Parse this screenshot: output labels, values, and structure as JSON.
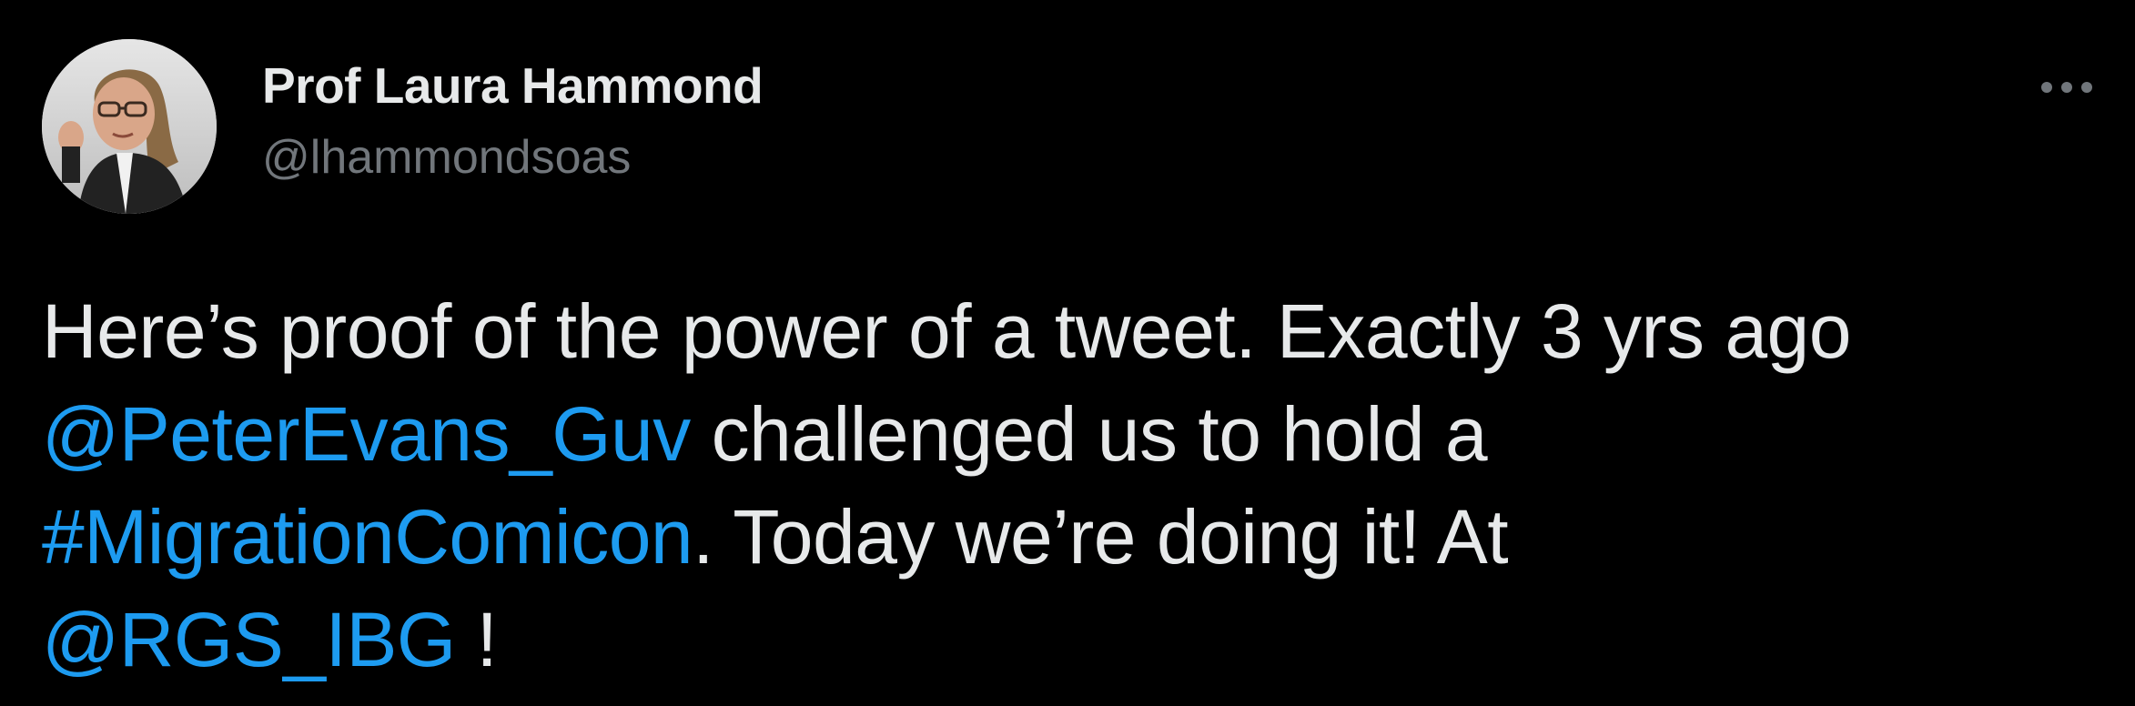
{
  "author": {
    "display_name": "Prof Laura Hammond",
    "handle": "@lhammondsoas"
  },
  "more_icon": "more-horizontal-icon",
  "tweet": {
    "line1": "Here’s proof of the power of a tweet. Exactly 3 yrs ago",
    "mention1": "@PeterEvans_Guv",
    "line2_rest": " challenged us to hold a",
    "hashtag": "#MigrationComicon",
    "line3_rest": ". Today we’re doing it! At",
    "mention2": "@RGS_IBG",
    "line4_rest": " !"
  },
  "colors": {
    "background": "#000000",
    "text": "#e7e9ea",
    "secondary": "#71767b",
    "link": "#1d9bf0"
  }
}
